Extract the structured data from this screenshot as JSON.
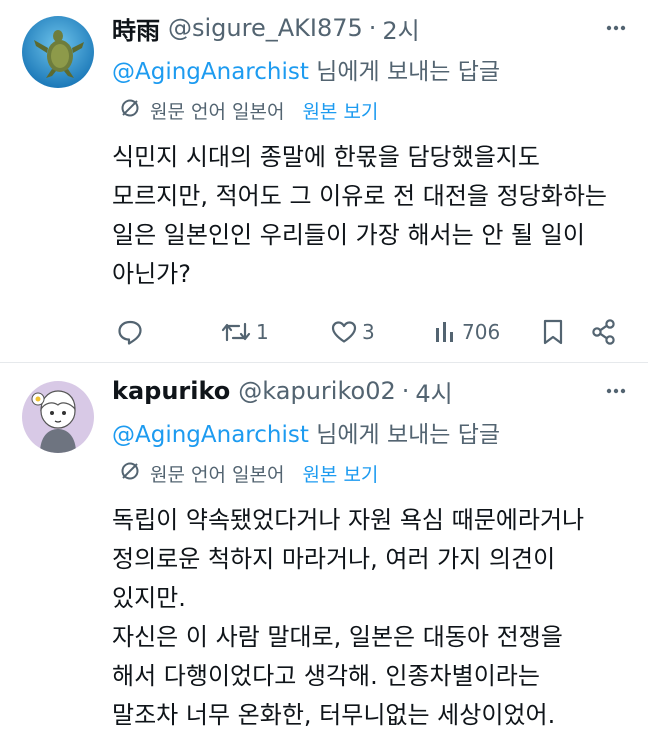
{
  "tweets": [
    {
      "name": "時雨",
      "handle": "@sigure_AKI875",
      "time": "2시",
      "reply_mention": "@AgingAnarchist",
      "reply_suffix": " 님에게 보내는 답글",
      "translate_lang": "원문 언어 일본어",
      "translate_show": "원본 보기",
      "body_lines": [
        "식민지 시대의 종말에 한몫을 담당했을지도",
        "모르지만, 적어도 그 이유로 전 대전을 정당화하는",
        "일은 일본인인 우리들이 가장 해서는 안 될 일이",
        "아닌가?"
      ],
      "retweets": "1",
      "likes": "3",
      "views": "706",
      "avatar_icon": "sea-turtle-avatar"
    },
    {
      "name": "kapuriko",
      "handle": "@kapuriko02",
      "time": "4시",
      "reply_mention": "@AgingAnarchist",
      "reply_suffix": " 님에게 보내는 답글",
      "translate_lang": "원문 언어 일본어",
      "translate_show": "원본 보기",
      "body_lines": [
        "독립이 약속됐었다거나 자원 욕심 때문에라거나",
        "정의로운 척하지 마라거나, 여러 가지 의견이",
        "있지만.",
        "자신은 이 사람 말대로, 일본은 대동아 전쟁을",
        "해서 다행이었다고 생각해. 인종차별이라는",
        "말조차 너무 온화한, 터무니없는 세상이었어."
      ],
      "avatar_icon": "anime-character-avatar"
    }
  ],
  "colors": {
    "link": "#1d9bf0",
    "secondary": "#536471",
    "text": "#0f1419"
  }
}
